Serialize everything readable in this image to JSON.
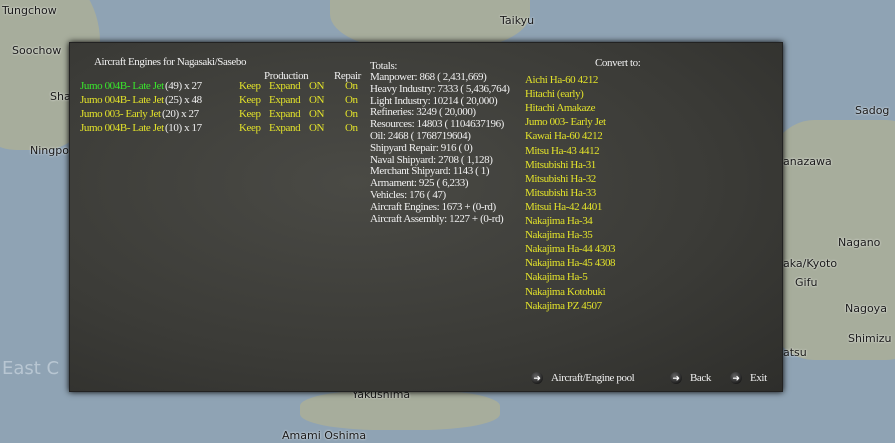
{
  "map": {
    "labels": [
      "Tungchow",
      "Soochow",
      "Sha",
      "Ningpo",
      "Taikyu",
      "Sadog",
      "anazawa",
      "Nagano",
      "aka/Kyoto",
      "Gifu",
      "Nagoya",
      "Shimizu",
      "atsu",
      "Yakushima",
      "Amami Oshima"
    ],
    "sea_label": "East C"
  },
  "dialog": {
    "title": "Aircraft Engines for Nagasaki/Sasebo",
    "col_production": "Production",
    "col_repair": "Repair",
    "engines": [
      {
        "name": "Jumo 004B- Late Jet",
        "detail": "(49) x 27",
        "keep": "Keep",
        "expand": "Expand",
        "on": "ON",
        "repair": "On",
        "selected": true
      },
      {
        "name": "Jumo 004B- Late Jet",
        "detail": "(25) x 48",
        "keep": "Keep",
        "expand": "Expand",
        "on": "ON",
        "repair": "On",
        "selected": false
      },
      {
        "name": "Jumo 003- Early Jet",
        "detail": "(20) x 27",
        "keep": "Keep",
        "expand": "Expand",
        "on": "ON",
        "repair": "On",
        "selected": false
      },
      {
        "name": "Jumo 004B- Late Jet",
        "detail": "(10) x 17",
        "keep": "Keep",
        "expand": "Expand",
        "on": "ON",
        "repair": "On",
        "selected": false
      }
    ],
    "totals_title": "Totals:",
    "totals": [
      "Manpower: 868 ( 2,431,669)",
      "Heavy Industry: 7333 ( 5,436,764)",
      "Light Industry: 10214 ( 20,000)",
      "Refineries: 3249 ( 20,000)",
      "Resources: 14803 ( 1104637196)",
      "Oil: 2468 ( 1768719604)",
      "Shipyard Repair: 916 ( 0)",
      "Naval Shipyard: 2708 ( 1,128)",
      "Merchant Shipyard: 1143 ( 1)",
      "Armament: 925 ( 6,233)",
      "Vehicles: 176 ( 47)",
      "Aircraft Engines: 1673 + (0-rd)",
      "Aircraft Assembly: 1227 + (0-rd)"
    ],
    "convert_title": "Convert to:",
    "convert": [
      "Aichi Ha-60 4212",
      "Hitachi (early)",
      "Hitachi Amakaze",
      "Jumo 003- Early Jet",
      "Kawai Ha-60 4212",
      "Mitsu Ha-43 4412",
      "Mitsubishi Ha-31",
      "Mitsubishi Ha-32",
      "Mitsubishi Ha-33",
      "Mitsui Ha-42 4401",
      "Nakajima Ha-34",
      "Nakajima Ha-35",
      "Nakajima Ha-44 4303",
      "Nakajima Ha-45 4308",
      "Nakajima Ha-5",
      "Nakajima Kotobuki",
      "Nakajima PZ 4507"
    ],
    "buttons": {
      "pool": "Aircraft/Engine pool",
      "back": "Back",
      "exit": "Exit"
    }
  }
}
